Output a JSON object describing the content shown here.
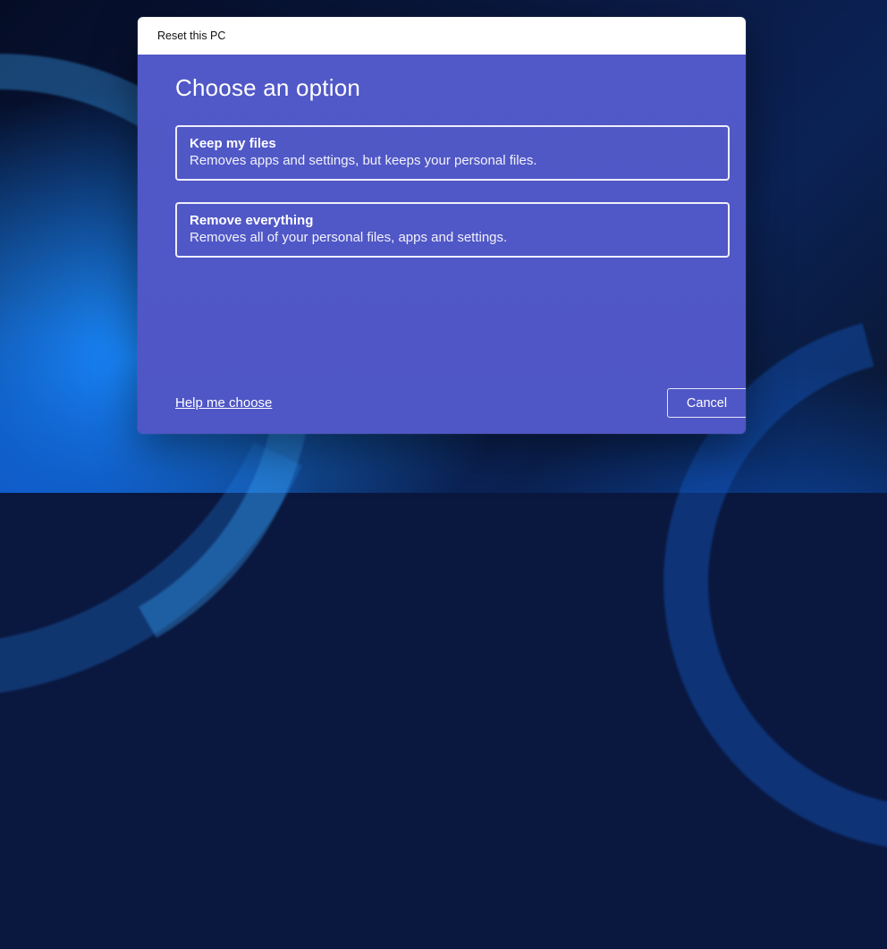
{
  "dialog": {
    "title": "Reset this PC",
    "heading": "Choose an option",
    "options": [
      {
        "title": "Keep my files",
        "description": "Removes apps and settings, but keeps your personal files."
      },
      {
        "title": "Remove everything",
        "description": "Removes all of your personal files, apps and settings."
      }
    ],
    "help_link": "Help me choose",
    "cancel_label": "Cancel"
  }
}
